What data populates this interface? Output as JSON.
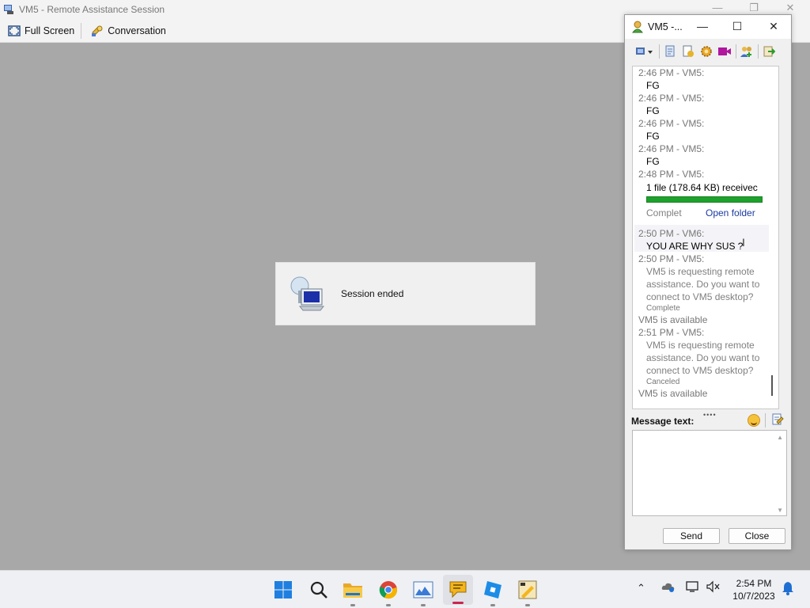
{
  "window": {
    "title": "VM5 - Remote Assistance Session",
    "controls": [
      "minimize-icon",
      "restore-icon",
      "close-icon"
    ]
  },
  "toolbar": {
    "full_screen_label": "Full Screen",
    "conversation_label": "Conversation"
  },
  "session": {
    "message": "Session ended"
  },
  "chat": {
    "title": "VM5 -...",
    "messages": [
      {
        "ts": "2:46 PM - VM5:",
        "text": "FG"
      },
      {
        "ts": "2:46 PM - VM5:",
        "text": "FG"
      },
      {
        "ts": "2:46 PM - VM5:",
        "text": "FG"
      },
      {
        "ts": "2:46 PM - VM5:",
        "text": "FG"
      }
    ],
    "file_transfer": {
      "ts": "2:48 PM - VM5:",
      "text": "1 file (178.64 KB) receivec",
      "progress": 1.0,
      "status": "Complet⁠e",
      "status_visible": "Complet",
      "open_folder": "Open folder"
    },
    "vm6_message": {
      "ts": "2:50 PM - VM6:",
      "text": "YOU ARE WHY SUS ?"
    },
    "request_1": {
      "ts": "2:50 PM - VM5:",
      "lines": [
        "VM5 is requesting remote",
        "assistance. Do you want to",
        "connect to VM5 desktop?"
      ],
      "status": "Complete"
    },
    "available_1": "VM5 is available",
    "request_2": {
      "ts": "2:51 PM - VM5:",
      "lines": [
        "VM5 is requesting remote",
        "assistance. Do you want to",
        "connect to VM5 desktop?"
      ],
      "status": "Canceled"
    },
    "available_2": "VM5 is available",
    "message_label": "Message text:",
    "input_value": "",
    "send_label": "Send",
    "close_label": "Close",
    "colors": {
      "progress": "#1ea12d",
      "link": "#1a3aa0"
    }
  },
  "taskbar": {
    "apps": [
      "windows-start-icon",
      "search-icon",
      "file-explorer-icon",
      "chrome-icon",
      "photos-icon",
      "chat-icon",
      "roblox-icon",
      "paint-icon"
    ],
    "time": "2:54 PM",
    "date": "10/7/2023"
  }
}
